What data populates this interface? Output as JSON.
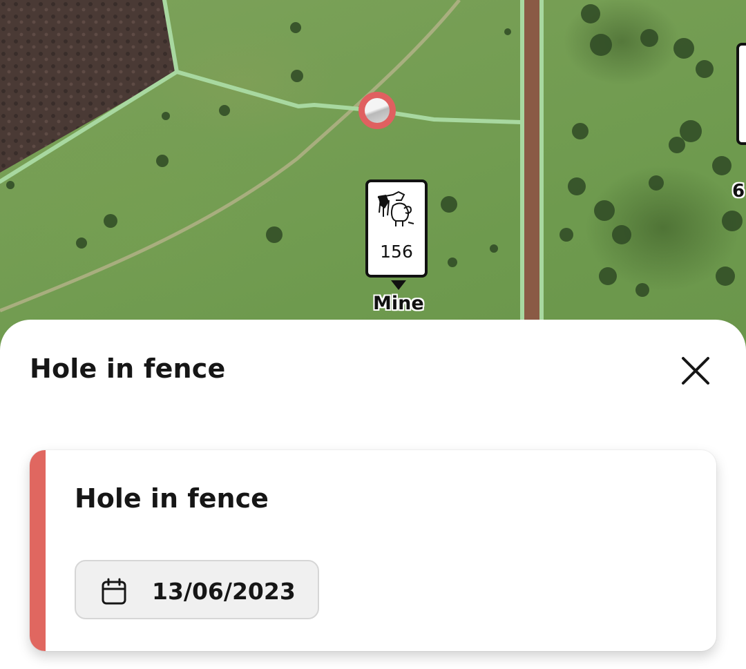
{
  "map": {
    "paddock_label": "Mine",
    "livestock_count": "156",
    "side_label": "6",
    "icons": {
      "livestock": "cow-sheep-icon",
      "hole": "hole-in-fence-marker-icon"
    },
    "colors": {
      "fence_line": "#a8d8a0",
      "road": "#8a5a45",
      "hole_marker": "#e06060"
    }
  },
  "sheet": {
    "title": "Hole in fence",
    "close_icon": "close-icon",
    "card": {
      "title": "Hole in fence",
      "date": "13/06/2023",
      "date_icon": "calendar-icon",
      "accent_color": "#e06760"
    }
  }
}
